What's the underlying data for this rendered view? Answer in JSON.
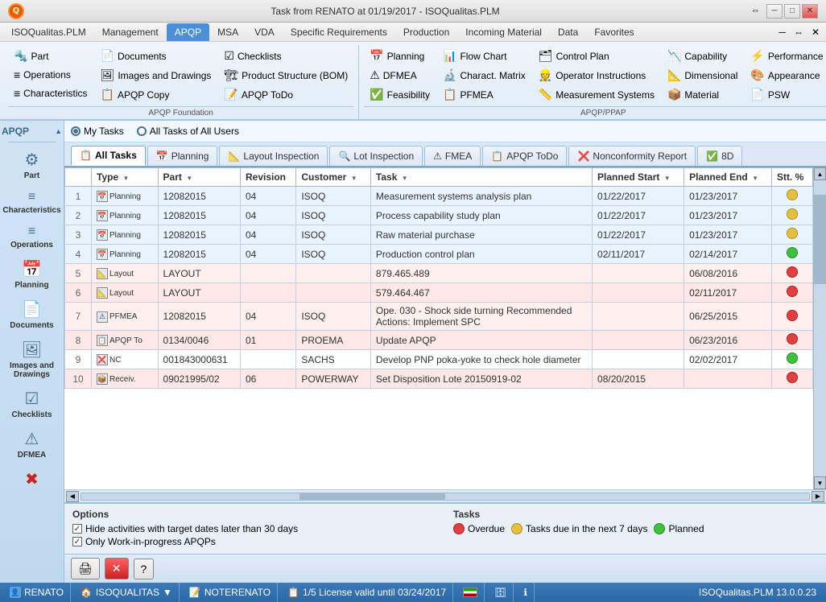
{
  "titleBar": {
    "title": "Task from RENATO at 01/19/2017 - ISOQualitas.PLM",
    "minBtn": "─",
    "maxBtn": "□",
    "closeBtn": "✕",
    "restoreBtn": "⇔"
  },
  "menuBar": {
    "items": [
      {
        "label": "ISOQualitas.PLM",
        "active": false
      },
      {
        "label": "Management",
        "active": false
      },
      {
        "label": "APQP",
        "active": true
      },
      {
        "label": "MSA",
        "active": false
      },
      {
        "label": "VDA",
        "active": false
      },
      {
        "label": "Specific Requirements",
        "active": false
      },
      {
        "label": "Production",
        "active": false
      },
      {
        "label": "Incoming Material",
        "active": false
      },
      {
        "label": "Data",
        "active": false
      },
      {
        "label": "Favorites",
        "active": false
      }
    ]
  },
  "ribbon": {
    "groups": [
      {
        "label": "APQP Foundation",
        "items": [
          {
            "icon": "🔩",
            "label": "Part"
          },
          {
            "icon": "📄",
            "label": "Documents"
          },
          {
            "icon": "☑",
            "label": "Checklists"
          },
          {
            "icon": "🖼",
            "label": "Images and Drawings"
          },
          {
            "icon": "🏗",
            "label": "Product Structure (BOM)"
          },
          {
            "icon": "📋",
            "label": "APQP Copy"
          },
          {
            "icon": "📝",
            "label": "APQP ToDo"
          }
        ]
      },
      {
        "label": "APQP/PPAP",
        "items": [
          {
            "icon": "📅",
            "label": "Planning"
          },
          {
            "icon": "📊",
            "label": "Flow Chart"
          },
          {
            "icon": "⚠",
            "label": "DFMEA"
          },
          {
            "icon": "🔬",
            "label": "Charact. Matrix"
          },
          {
            "icon": "✅",
            "label": "Feasibility"
          },
          {
            "icon": "📋",
            "label": "PFMEA"
          },
          {
            "icon": "🗂",
            "label": "Control Plan"
          },
          {
            "icon": "👷",
            "label": "Operator Instructions"
          },
          {
            "icon": "📏",
            "label": "Measurement Systems"
          },
          {
            "icon": "📉",
            "label": "Capability"
          },
          {
            "icon": "📐",
            "label": "Dimensional"
          },
          {
            "icon": "📦",
            "label": "Material"
          },
          {
            "icon": "⚡",
            "label": "Performance"
          },
          {
            "icon": "🎨",
            "label": "Appearance"
          },
          {
            "icon": "📄",
            "label": "PSW"
          }
        ]
      }
    ]
  },
  "sidebar": {
    "apqpLabel": "APQP",
    "items": [
      {
        "icon": "⚙",
        "label": "Part"
      },
      {
        "icon": "≡",
        "label": "Characteristics"
      },
      {
        "icon": "≡",
        "label": "Operations"
      },
      {
        "icon": "📅",
        "label": "Planning"
      },
      {
        "icon": "📄",
        "label": "Documents"
      },
      {
        "icon": "🖼",
        "label": "Images and Drawings"
      },
      {
        "icon": "☑",
        "label": "Checklists"
      },
      {
        "icon": "⚠",
        "label": "DFMEA"
      },
      {
        "icon": "✖",
        "label": ""
      }
    ]
  },
  "taskSelector": {
    "option1": "My Tasks",
    "option2": "All Tasks of All Users"
  },
  "tabs": [
    {
      "label": "All Tasks",
      "icon": "📋",
      "active": true
    },
    {
      "label": "Planning",
      "icon": "📅",
      "active": false
    },
    {
      "label": "Layout Inspection",
      "icon": "📐",
      "active": false
    },
    {
      "label": "Lot Inspection",
      "icon": "🔍",
      "active": false
    },
    {
      "label": "FMEA",
      "icon": "⚠",
      "active": false
    },
    {
      "label": "APQP ToDo",
      "icon": "📋",
      "active": false
    },
    {
      "label": "Nonconformity Report",
      "icon": "❌",
      "active": false
    },
    {
      "label": "8D",
      "icon": "✅",
      "active": false
    }
  ],
  "tableHeaders": [
    {
      "label": "",
      "width": "30"
    },
    {
      "label": "Type",
      "sort": true,
      "width": "80"
    },
    {
      "label": "Part",
      "sort": true,
      "width": "90"
    },
    {
      "label": "Revision",
      "width": "60"
    },
    {
      "label": "Customer",
      "sort": true,
      "width": "60"
    },
    {
      "label": "Task",
      "sort": true,
      "width": "280"
    },
    {
      "label": "Planned Start",
      "sort": true,
      "width": "80"
    },
    {
      "label": "Planned End",
      "sort": true,
      "width": "80"
    },
    {
      "label": "Stt. %",
      "width": "50"
    }
  ],
  "tableRows": [
    {
      "num": 1,
      "type": "Planning",
      "part": "12082015",
      "revision": "04",
      "customer": "ISOQ",
      "task": "Measurement systems analysis plan",
      "plannedStart": "01/22/2017",
      "plannedEnd": "01/23/2017",
      "status": "yellow",
      "rowClass": ""
    },
    {
      "num": 2,
      "type": "Planning",
      "part": "12082015",
      "revision": "04",
      "customer": "ISOQ",
      "task": "Process capability study plan",
      "plannedStart": "01/22/2017",
      "plannedEnd": "01/23/2017",
      "status": "yellow",
      "rowClass": ""
    },
    {
      "num": 3,
      "type": "Planning",
      "part": "12082015",
      "revision": "04",
      "customer": "ISOQ",
      "task": "Raw material purchase",
      "plannedStart": "01/22/2017",
      "plannedEnd": "01/23/2017",
      "status": "yellow",
      "rowClass": ""
    },
    {
      "num": 4,
      "type": "Planning",
      "part": "12082015",
      "revision": "04",
      "customer": "ISOQ",
      "task": "Production control plan",
      "plannedStart": "02/11/2017",
      "plannedEnd": "02/14/2017",
      "status": "green",
      "rowClass": ""
    },
    {
      "num": 5,
      "type": "Layout",
      "part": "LAYOUT",
      "revision": "",
      "customer": "",
      "task": "879.465.489",
      "plannedStart": "",
      "plannedEnd": "06/08/2016",
      "status": "red",
      "rowClass": "row-pink"
    },
    {
      "num": 6,
      "type": "Layout",
      "part": "LAYOUT",
      "revision": "",
      "customer": "",
      "task": "579.464.467",
      "plannedStart": "",
      "plannedEnd": "02/11/2017",
      "status": "red",
      "rowClass": "row-pink"
    },
    {
      "num": 7,
      "type": "PFMEA",
      "part": "12082015",
      "revision": "04",
      "customer": "ISOQ",
      "task": "Ope. 030 - Shock side turning Recommended Actions: Implement SPC",
      "plannedStart": "",
      "plannedEnd": "06/25/2015",
      "status": "red",
      "rowClass": "row-pink"
    },
    {
      "num": 8,
      "type": "APQP To",
      "part": "0134/0046",
      "revision": "01",
      "customer": "PROEMA",
      "task": "Update APQP",
      "plannedStart": "",
      "plannedEnd": "06/23/2016",
      "status": "red",
      "rowClass": "row-pink"
    },
    {
      "num": 9,
      "type": "NC",
      "part": "001843000631",
      "revision": "",
      "customer": "SACHS",
      "task": "Develop PNP poka-yoke to check hole diameter",
      "plannedStart": "",
      "plannedEnd": "02/02/2017",
      "status": "green",
      "rowClass": ""
    },
    {
      "num": 10,
      "type": "Receiv.",
      "part": "09021995/02",
      "revision": "06",
      "customer": "POWERWAY",
      "task": "Set Disposition Lote 20150919-02",
      "plannedStart": "08/20/2015",
      "plannedEnd": "",
      "status": "red",
      "rowClass": "row-pink"
    }
  ],
  "options": {
    "title": "Options",
    "cb1": {
      "checked": true,
      "label": "Hide activities with target dates later than 30 days"
    },
    "cb2": {
      "checked": true,
      "label": "Only Work-in-progress APQPs"
    }
  },
  "legend": {
    "title": "Tasks",
    "items": [
      {
        "color": "red",
        "label": "Overdue"
      },
      {
        "color": "yellow",
        "label": "Tasks due in the next 7 days"
      },
      {
        "color": "green",
        "label": "Planned"
      }
    ]
  },
  "statusBar": {
    "user": "RENATO",
    "company": "ISOQUALITAS",
    "companyArrow": "▼",
    "notepad": "NOTERENATO",
    "license": "1/5 License valid until 03/24/2017",
    "appVersion": "ISOQualitas.PLM 13.0.0.23"
  }
}
